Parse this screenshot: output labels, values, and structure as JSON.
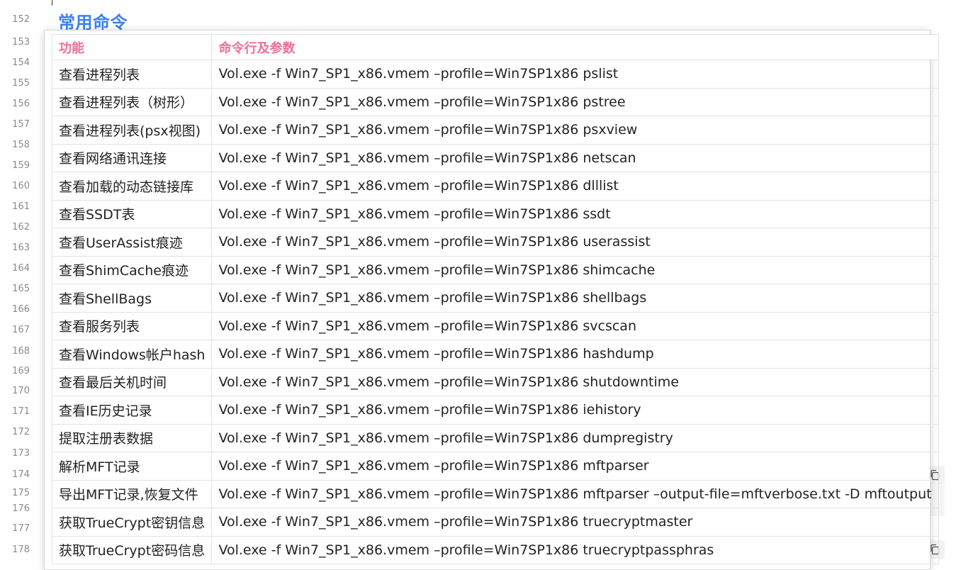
{
  "line_numbers": [
    "152",
    "153",
    "154",
    "155",
    "156",
    "157",
    "158",
    "159",
    "160",
    "161",
    "162",
    "163",
    "164",
    "165",
    "166",
    "167",
    "168",
    "169",
    "170",
    "171",
    "172",
    "173",
    "174",
    "175",
    "176",
    "177",
    "178"
  ],
  "heading": "常用命令",
  "table": {
    "headers": [
      "功能",
      "命令行及参数"
    ],
    "rows": [
      [
        "查看进程列表",
        "Vol.exe -f Win7_SP1_x86.vmem –profile=Win7SP1x86 pslist"
      ],
      [
        "查看进程列表（树形）",
        "Vol.exe -f Win7_SP1_x86.vmem –profile=Win7SP1x86 pstree"
      ],
      [
        "查看进程列表(psx视图)",
        "Vol.exe -f Win7_SP1_x86.vmem –profile=Win7SP1x86 psxview"
      ],
      [
        "查看网络通讯连接",
        "Vol.exe -f Win7_SP1_x86.vmem –profile=Win7SP1x86 netscan"
      ],
      [
        "查看加载的动态链接库",
        "Vol.exe -f Win7_SP1_x86.vmem –profile=Win7SP1x86 dlllist"
      ],
      [
        "查看SSDT表",
        "Vol.exe -f Win7_SP1_x86.vmem –profile=Win7SP1x86 ssdt"
      ],
      [
        "查看UserAssist痕迹",
        "Vol.exe -f Win7_SP1_x86.vmem –profile=Win7SP1x86 userassist"
      ],
      [
        "查看ShimCache痕迹",
        "Vol.exe -f Win7_SP1_x86.vmem –profile=Win7SP1x86 shimcache"
      ],
      [
        "查看ShellBags",
        "Vol.exe -f Win7_SP1_x86.vmem –profile=Win7SP1x86 shellbags"
      ],
      [
        "查看服务列表",
        "Vol.exe -f Win7_SP1_x86.vmem –profile=Win7SP1x86 svcscan"
      ],
      [
        "查看Windows帐户hash",
        "Vol.exe -f Win7_SP1_x86.vmem –profile=Win7SP1x86 hashdump"
      ],
      [
        "查看最后关机时间",
        "Vol.exe -f Win7_SP1_x86.vmem –profile=Win7SP1x86 shutdowntime"
      ],
      [
        "查看IE历史记录",
        "Vol.exe -f Win7_SP1_x86.vmem –profile=Win7SP1x86 iehistory"
      ],
      [
        "提取注册表数据",
        "Vol.exe -f Win7_SP1_x86.vmem –profile=Win7SP1x86 dumpregistry"
      ],
      [
        "解析MFT记录",
        "Vol.exe -f Win7_SP1_x86.vmem –profile=Win7SP1x86 mftparser"
      ],
      [
        "导出MFT记录,恢复文件",
        "Vol.exe -f Win7_SP1_x86.vmem –profile=Win7SP1x86 mftparser –output-file=mftverbose.txt -D mftoutput"
      ],
      [
        "获取TrueCrypt密钥信息",
        "Vol.exe -f Win7_SP1_x86.vmem –profile=Win7SP1x86 truecryptmaster"
      ],
      [
        "获取TrueCrypt密码信息",
        "Vol.exe -f Win7_SP1_x86.vmem –profile=Win7SP1x86 truecryptpassphras"
      ]
    ]
  },
  "icons": {
    "copy": "copy-icon"
  }
}
